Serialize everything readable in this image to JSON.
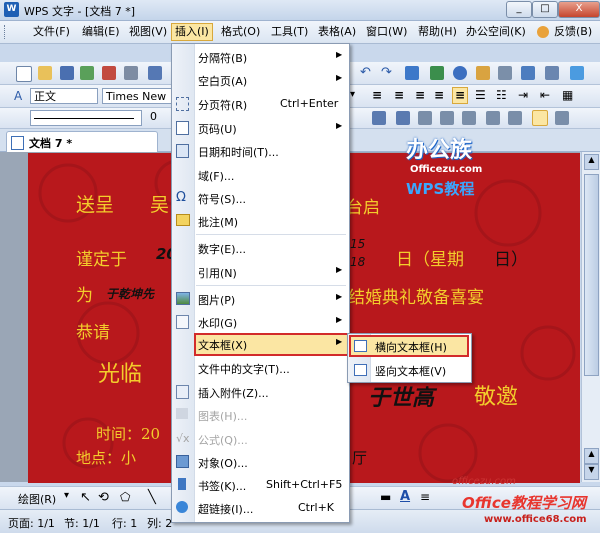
{
  "window": {
    "title": "WPS 文字 - [文档 7 *]",
    "logo": "W",
    "buttons": [
      "_",
      "□",
      "X"
    ]
  },
  "menubar": {
    "items": [
      "文件(F)",
      "编辑(E)",
      "视图(V)",
      "插入(I)",
      "格式(O)",
      "工具(T)",
      "表格(A)",
      "窗口(W)",
      "帮助(H)",
      "办公空间(K)",
      "反馈(B)"
    ]
  },
  "format_toolbar": {
    "style": "正文",
    "font": "Times New R"
  },
  "tabs": {
    "doc_tab": "文档 7 *"
  },
  "watermark": {
    "line1": "办公族",
    "line2": "Officezu.com",
    "line3": "WPS教程"
  },
  "document": {
    "line1_left": "送呈",
    "line1_name": "吴",
    "line1_right": "台启",
    "line2_left": "谨定于",
    "line2_year": "20",
    "line2_num1": "15",
    "line2_num2": "18",
    "line2_right": "日（星期",
    "line2_end": "日）",
    "line3_left": "为",
    "line3_hand": "于乾坤先",
    "line3_right": "结婚典礼敬备喜宴",
    "line4": "恭请",
    "line5_left": "光临",
    "line5_hand": "于世高",
    "line5_right": "敬邀",
    "line6": "时间：20",
    "line7": "地点：小",
    "line7_end": "厅"
  },
  "insert_menu": {
    "items": [
      {
        "label": "分隔符(B)",
        "arrow": true,
        "icon": ""
      },
      {
        "label": "空白页(A)",
        "arrow": true,
        "icon": ""
      },
      {
        "label": "分页符(R)",
        "shortcut": "Ctrl+Enter",
        "icon": "page-break-icon"
      },
      {
        "label": "页码(U)",
        "arrow": true,
        "icon": "page-number-icon"
      },
      {
        "label": "日期和时间(T)...",
        "icon": "date-icon"
      },
      {
        "label": "域(F)...",
        "icon": ""
      },
      {
        "label": "符号(S)...",
        "icon": "omega-icon"
      },
      {
        "label": "批注(M)",
        "icon": "comment-icon"
      },
      {
        "label": "数字(E)...",
        "icon": ""
      },
      {
        "label": "引用(N)",
        "arrow": true,
        "icon": ""
      },
      {
        "label": "图片(P)",
        "arrow": true,
        "icon": "picture-icon"
      },
      {
        "label": "水印(G)",
        "arrow": true,
        "icon": "watermark-icon"
      },
      {
        "label": "文本框(X)",
        "arrow": true,
        "icon": ""
      },
      {
        "label": "文件中的文字(T)...",
        "icon": ""
      },
      {
        "label": "插入附件(Z)...",
        "icon": "attachment-icon"
      },
      {
        "label": "图表(H)...",
        "icon": "chart-icon",
        "disabled": true
      },
      {
        "label": "公式(Q)...",
        "icon": "formula-icon",
        "disabled": true
      },
      {
        "label": "对象(O)...",
        "icon": "object-icon"
      },
      {
        "label": "书签(K)...",
        "shortcut": "Shift+Ctrl+F5",
        "icon": "bookmark-icon"
      },
      {
        "label": "超链接(I)...",
        "shortcut": "Ctrl+K",
        "icon": "hyperlink-icon"
      }
    ]
  },
  "textbox_submenu": {
    "items": [
      "横向文本框(H)",
      "竖向文本框(V)"
    ]
  },
  "drawbar": {
    "draw_label": "绘图(R)"
  },
  "statusbar": {
    "page": "页面: 1/1",
    "section": "节: 1/1",
    "row": "行: 1",
    "col": "列: 2"
  },
  "footer_logo": {
    "line1": "Office教程学习网",
    "line2": "www.office68.com"
  },
  "colors": {
    "accent": "#d8a83c",
    "highlight_box": "#d22b2b",
    "doc_bg": "#b8181c",
    "doc_text": "#f3cd2c"
  }
}
